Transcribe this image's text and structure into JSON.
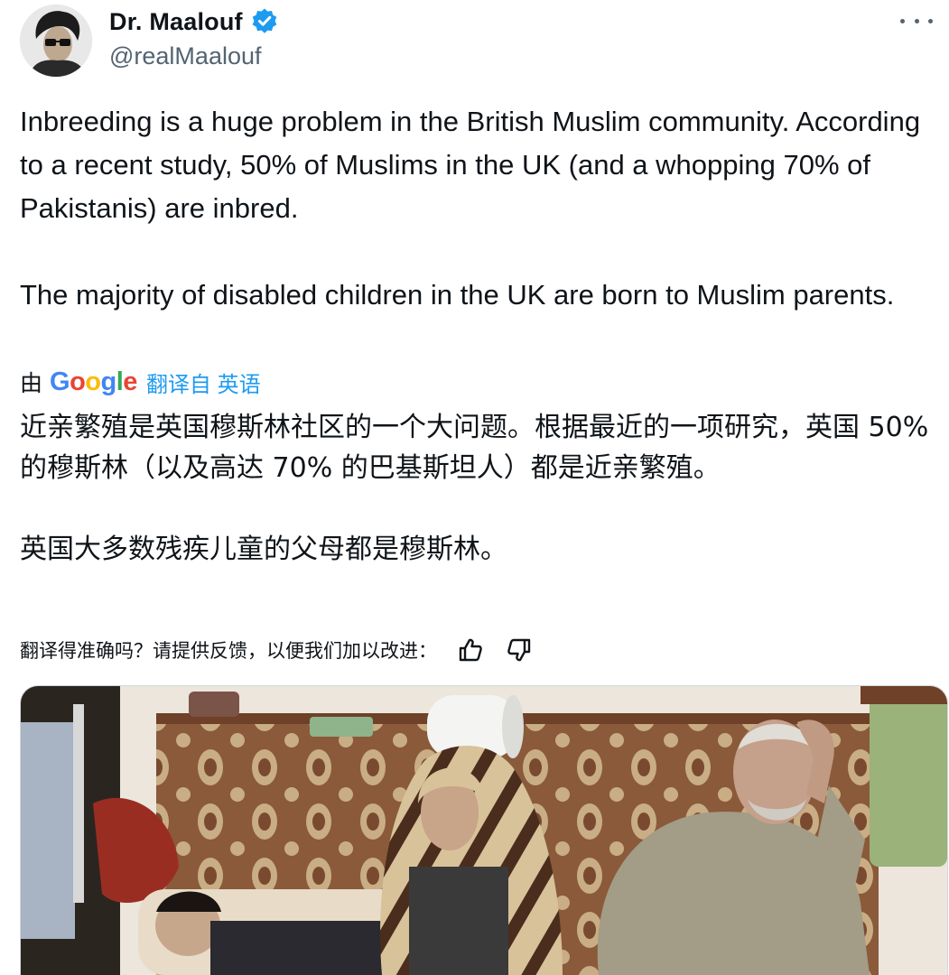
{
  "author": {
    "display_name": "Dr. Maalouf",
    "handle": "@realMaalouf",
    "verified": true,
    "avatar_icon": "avatar-photo"
  },
  "tweet": {
    "text_para1": "Inbreeding is a huge problem in the British Muslim community. According to a recent study, 50% of Muslims in the UK (and a whopping 70% of Pakistanis) are inbred.",
    "text_para2": "The majority of disabled children in the UK are born to Muslim parents."
  },
  "translation": {
    "by_label": "由",
    "provider": "Google",
    "link_label": "翻译自 英语",
    "text_para1": "近亲繁殖是英国穆斯林社区的一个大问题。根据最近的一项研究，英国 50% 的穆斯林（以及高达 70% 的巴基斯坦人）都是近亲繁殖。",
    "text_para2": "英国大多数残疾儿童的父母都是穆斯林。",
    "feedback_prompt": "翻译得准确吗？请提供反馈，以便我们加以改进："
  },
  "icons": {
    "verified": "verified-badge-icon",
    "more": "more-options-icon",
    "thumbs_up": "thumbs-up-icon",
    "thumbs_down": "thumbs-down-icon"
  },
  "colors": {
    "accent": "#1d9bf0",
    "text": "#0f1419",
    "secondary": "#536471"
  }
}
